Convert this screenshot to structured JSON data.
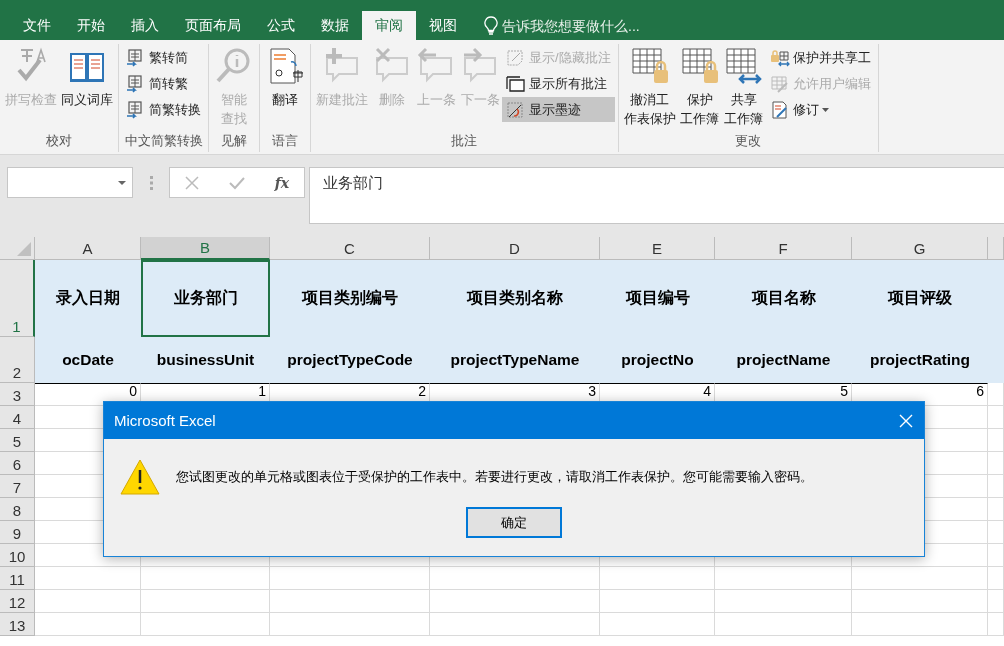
{
  "tabs": [
    {
      "label": "文件",
      "selected": false
    },
    {
      "label": "开始",
      "selected": false
    },
    {
      "label": "插入",
      "selected": false
    },
    {
      "label": "页面布局",
      "selected": false
    },
    {
      "label": "公式",
      "selected": false
    },
    {
      "label": "数据",
      "selected": false
    },
    {
      "label": "审阅",
      "selected": true
    },
    {
      "label": "视图",
      "selected": false
    }
  ],
  "tell_me": {
    "placeholder": "告诉我您想要做什么..."
  },
  "ribbon": [
    {
      "label": "校对",
      "items": [
        {
          "kind": "large",
          "lines": [
            "拼写检查"
          ],
          "disabled": true
        },
        {
          "kind": "large",
          "lines": [
            "同义词库"
          ],
          "disabled": false
        }
      ]
    },
    {
      "label": "中文简繁转换",
      "items": [
        {
          "kind": "stack",
          "items": [
            {
              "label": "繁转简",
              "disabled": false,
              "selected": false
            },
            {
              "label": "简转繁",
              "disabled": false,
              "selected": false
            },
            {
              "label": "简繁转换",
              "disabled": false,
              "selected": false
            }
          ]
        }
      ]
    },
    {
      "label": "见解",
      "items": [
        {
          "kind": "large",
          "lines": [
            "智能",
            "查找"
          ],
          "disabled": true
        }
      ]
    },
    {
      "label": "语言",
      "items": [
        {
          "kind": "large",
          "lines": [
            "翻译"
          ],
          "disabled": false
        }
      ]
    },
    {
      "label": "批注",
      "items": [
        {
          "kind": "large",
          "lines": [
            "新建批注"
          ],
          "disabled": true
        },
        {
          "kind": "large",
          "lines": [
            "删除"
          ],
          "disabled": true
        },
        {
          "kind": "large",
          "lines": [
            "上一条"
          ],
          "disabled": true
        },
        {
          "kind": "large",
          "lines": [
            "下一条"
          ],
          "disabled": true
        },
        {
          "kind": "stack",
          "items": [
            {
              "label": "显示/隐藏批注",
              "disabled": true,
              "selected": false
            },
            {
              "label": "显示所有批注",
              "disabled": false,
              "selected": false
            },
            {
              "label": "显示墨迹",
              "disabled": false,
              "selected": true
            }
          ]
        }
      ]
    },
    {
      "label": "更改",
      "items": [
        {
          "kind": "large",
          "lines": [
            "撤消工",
            "作表保护"
          ],
          "disabled": false
        },
        {
          "kind": "large",
          "lines": [
            "保护",
            "工作簿"
          ],
          "disabled": false
        },
        {
          "kind": "large",
          "lines": [
            "共享",
            "工作簿"
          ],
          "disabled": false
        },
        {
          "kind": "stack",
          "items": [
            {
              "label": "保护并共享工",
              "disabled": false,
              "selected": false
            },
            {
              "label": "允许用户编辑",
              "disabled": true,
              "selected": false
            },
            {
              "label": "修订",
              "disabled": false,
              "selected": false,
              "dropdown": true
            }
          ]
        }
      ]
    }
  ],
  "formula_bar": {
    "fx": "fx",
    "value": "业务部门"
  },
  "sheet": {
    "columns": [
      {
        "label": "A",
        "selected": false
      },
      {
        "label": "B",
        "selected": true
      },
      {
        "label": "C",
        "selected": false
      },
      {
        "label": "D",
        "selected": false
      },
      {
        "label": "E",
        "selected": false
      },
      {
        "label": "F",
        "selected": false
      },
      {
        "label": "G",
        "selected": false
      }
    ],
    "rows": [
      {
        "label": "1",
        "selected": true,
        "kind": "header",
        "cells": [
          {
            "text": "录入日期",
            "active": false
          },
          {
            "text": "业务部门",
            "active": true
          },
          {
            "text": "项目类别编号",
            "active": false
          },
          {
            "text": "项目类别名称",
            "active": false
          },
          {
            "text": "项目编号",
            "active": false
          },
          {
            "text": "项目名称",
            "active": false
          },
          {
            "text": "项目评级",
            "active": false
          }
        ]
      },
      {
        "label": "2",
        "selected": false,
        "kind": "header",
        "cells": [
          {
            "text": "ocDate",
            "active": false
          },
          {
            "text": "businessUnit",
            "active": false
          },
          {
            "text": "projectTypeCode",
            "active": false
          },
          {
            "text": "projectTypeName",
            "active": false
          },
          {
            "text": "projectNo",
            "active": false
          },
          {
            "text": "projectName",
            "active": false
          },
          {
            "text": "projectRating",
            "active": false
          }
        ]
      },
      {
        "label": "3",
        "selected": false,
        "kind": "value",
        "cells": [
          {
            "text": "0",
            "active": false
          },
          {
            "text": "1",
            "active": false
          },
          {
            "text": "2",
            "active": false
          },
          {
            "text": "3",
            "active": false
          },
          {
            "text": "4",
            "active": false
          },
          {
            "text": "5",
            "active": false
          },
          {
            "text": "6",
            "active": false
          }
        ]
      },
      {
        "label": "4",
        "selected": false,
        "kind": "value"
      },
      {
        "label": "5",
        "selected": false,
        "kind": "value"
      },
      {
        "label": "6",
        "selected": false,
        "kind": "value"
      },
      {
        "label": "7",
        "selected": false,
        "kind": "value"
      },
      {
        "label": "8",
        "selected": false,
        "kind": "value"
      },
      {
        "label": "9",
        "selected": false,
        "kind": "value"
      },
      {
        "label": "10",
        "selected": false,
        "kind": "value"
      },
      {
        "label": "11",
        "selected": false,
        "kind": "value"
      },
      {
        "label": "12",
        "selected": false,
        "kind": "value"
      },
      {
        "label": "13",
        "selected": false,
        "kind": "value"
      }
    ]
  },
  "dialog": {
    "title": "Microsoft Excel",
    "message": "您试图更改的单元格或图表位于受保护的工作表中。若要进行更改，请取消工作表保护。您可能需要输入密码。",
    "button": "确定"
  }
}
